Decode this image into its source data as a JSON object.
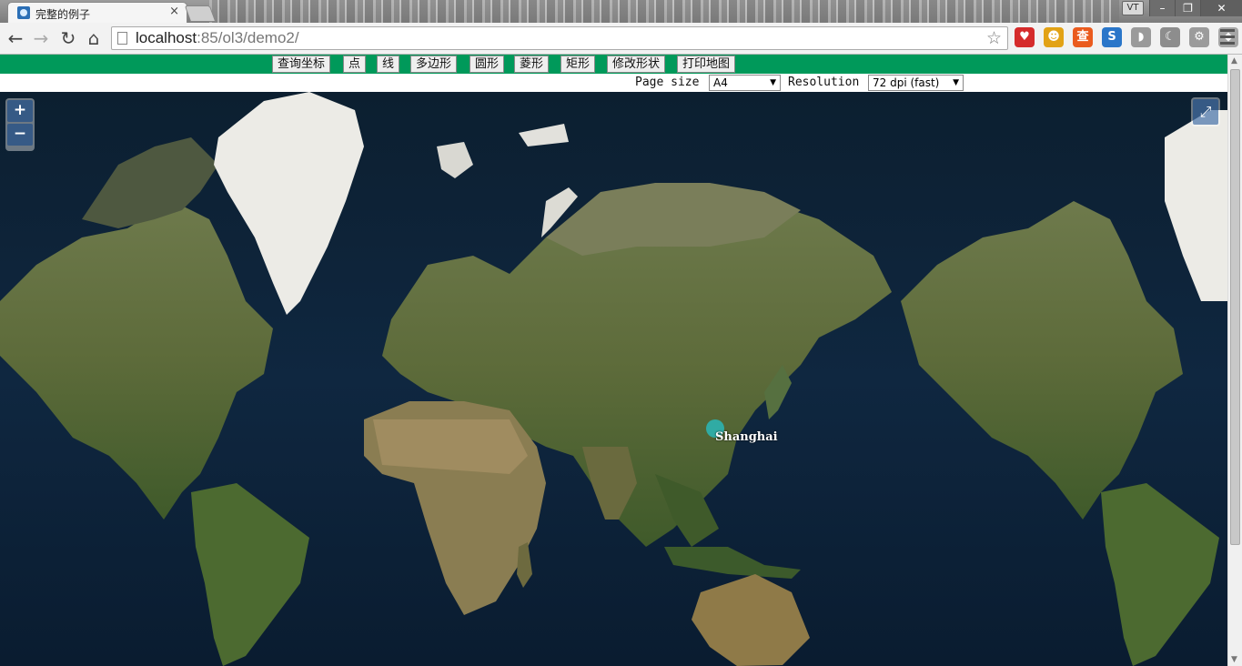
{
  "browser": {
    "tab_title": "完整的例子",
    "tab_close": "×",
    "user_badge": "VT",
    "window_buttons": {
      "minimize": "–",
      "maximize": "❐",
      "close": "✕"
    },
    "nav": {
      "back": "←",
      "forward": "→",
      "reload": "↻",
      "home": "⌂"
    },
    "url_host": "localhost",
    "url_rest": ":85/ol3/demo2/",
    "star": "☆",
    "extensions": [
      {
        "name": "heart-extension-icon",
        "glyph": "♥",
        "color": "#d52b2b"
      },
      {
        "name": "person-extension-icon",
        "glyph": "☻",
        "color": "#e2a215"
      },
      {
        "name": "translate-extension-icon",
        "glyph": "查",
        "color": "#ea5b1e"
      },
      {
        "name": "s-extension-icon",
        "glyph": "S",
        "color": "#2a76c9"
      },
      {
        "name": "shield-extension-icon",
        "glyph": "◗",
        "color": "#9a9a9a"
      },
      {
        "name": "moon-extension-icon",
        "glyph": "☾",
        "color": "#8d8d8d"
      },
      {
        "name": "gear-extension-icon",
        "glyph": "⚙",
        "color": "#9b9b9b"
      },
      {
        "name": "tag-extension-icon",
        "glyph": "◆",
        "color": "#a6a6a6"
      }
    ]
  },
  "toolbar_buttons": [
    "查询坐标",
    "点",
    "线",
    "多边形",
    "圆形",
    "菱形",
    "矩形",
    "修改形状",
    "打印地图"
  ],
  "print": {
    "page_size_label": "Page size",
    "page_size_value": "A4",
    "resolution_label": "Resolution",
    "resolution_value": "72 dpi (fast)"
  },
  "map": {
    "zoom_in": "+",
    "zoom_out": "−",
    "fullscreen": "⤢",
    "marker_label": "Shanghai",
    "marker_color": "#2ab7b7"
  },
  "scrollbar": {
    "up": "▲",
    "down": "▼"
  }
}
